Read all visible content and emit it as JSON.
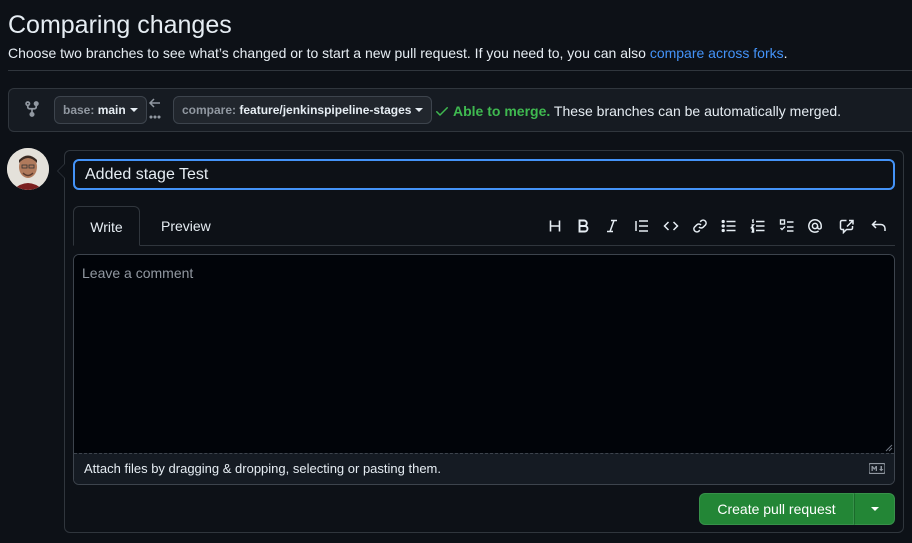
{
  "header": {
    "title": "Comparing changes",
    "description": "Choose two branches to see what’s changed or to start a new pull request. If you need to, you can also ",
    "link_text": "compare across forks",
    "description_end": "."
  },
  "range": {
    "base_label": "base:",
    "base_value": "main",
    "compare_label": "compare:",
    "compare_value": "feature/jenkinspipeline-stages",
    "merge_status": "Able to merge.",
    "merge_detail": " These branches can be automatically merged."
  },
  "form": {
    "title_value": "Added stage Test",
    "tabs": [
      "Write",
      "Preview"
    ],
    "comment_placeholder": "Leave a comment",
    "attach_text": "Attach files by dragging & dropping, selecting or pasting them.",
    "submit_label": "Create pull request"
  },
  "toolbar": {
    "icons": [
      "heading-icon",
      "bold-icon",
      "italic-icon",
      "quote-icon",
      "code-icon",
      "link-icon",
      "unordered-list-icon",
      "ordered-list-icon",
      "task-list-icon",
      "mention-icon",
      "reference-icon",
      "undo-icon"
    ]
  },
  "colors": {
    "background": "#0d1117",
    "accent_link": "#4493f8",
    "success": "#3fb950",
    "button_green": "#238636"
  }
}
